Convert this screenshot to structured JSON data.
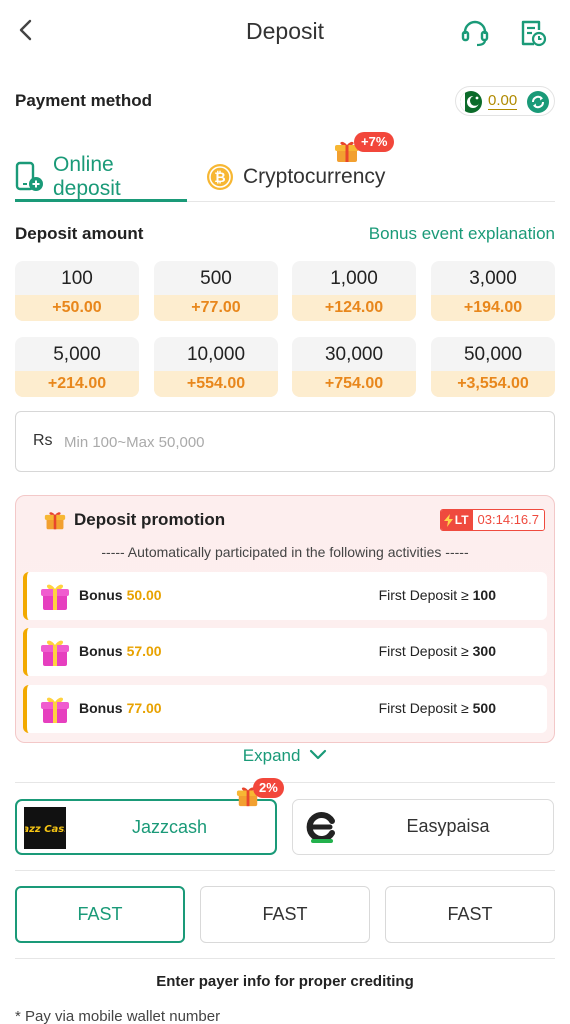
{
  "header": {
    "title": "Deposit"
  },
  "payment_method": {
    "label": "Payment method",
    "balance": "0.00"
  },
  "tabs": [
    {
      "label": "Online deposit",
      "active": true
    },
    {
      "label": "Cryptocurrency",
      "active": false,
      "tag": "+7%"
    }
  ],
  "deposit_amount": {
    "label": "Deposit amount",
    "bonus_link": "Bonus event explanation",
    "options": [
      {
        "amount": "100",
        "bonus": "+50.00"
      },
      {
        "amount": "500",
        "bonus": "+77.00"
      },
      {
        "amount": "1,000",
        "bonus": "+124.00"
      },
      {
        "amount": "3,000",
        "bonus": "+194.00"
      },
      {
        "amount": "5,000",
        "bonus": "+214.00"
      },
      {
        "amount": "10,000",
        "bonus": "+554.00"
      },
      {
        "amount": "30,000",
        "bonus": "+754.00"
      },
      {
        "amount": "50,000",
        "bonus": "+3,554.00"
      }
    ],
    "input": {
      "currency": "Rs",
      "placeholder": "Min 100~Max 50,000",
      "value": ""
    }
  },
  "promotion": {
    "title": "Deposit promotion",
    "lt_label": "LT",
    "countdown": "03:14:16.7",
    "subtitle": "----- Automatically participated in the following activities -----",
    "rows": [
      {
        "label": "Bonus",
        "amount": "50.00",
        "req_text": "First Deposit ≥",
        "req_value": "100"
      },
      {
        "label": "Bonus",
        "amount": "57.00",
        "req_text": "First Deposit ≥",
        "req_value": "300"
      },
      {
        "label": "Bonus",
        "amount": "77.00",
        "req_text": "First Deposit ≥",
        "req_value": "500"
      }
    ],
    "expand_label": "Expand"
  },
  "channels": [
    {
      "name": "Jazzcash",
      "logo_text": "Jazz Cash",
      "active": true,
      "tag": "2%"
    },
    {
      "name": "Easypaisa",
      "active": false
    }
  ],
  "speeds": [
    {
      "label": "FAST",
      "active": true
    },
    {
      "label": "FAST",
      "active": false
    },
    {
      "label": "FAST",
      "active": false
    }
  ],
  "payer_info": {
    "title": "Enter payer info for proper crediting",
    "cut_text": "* Pay via mobile wallet number"
  },
  "colors": {
    "accent": "#1a9a78",
    "bonus_orange": "#e8871c",
    "badge_red": "#f2473b"
  }
}
